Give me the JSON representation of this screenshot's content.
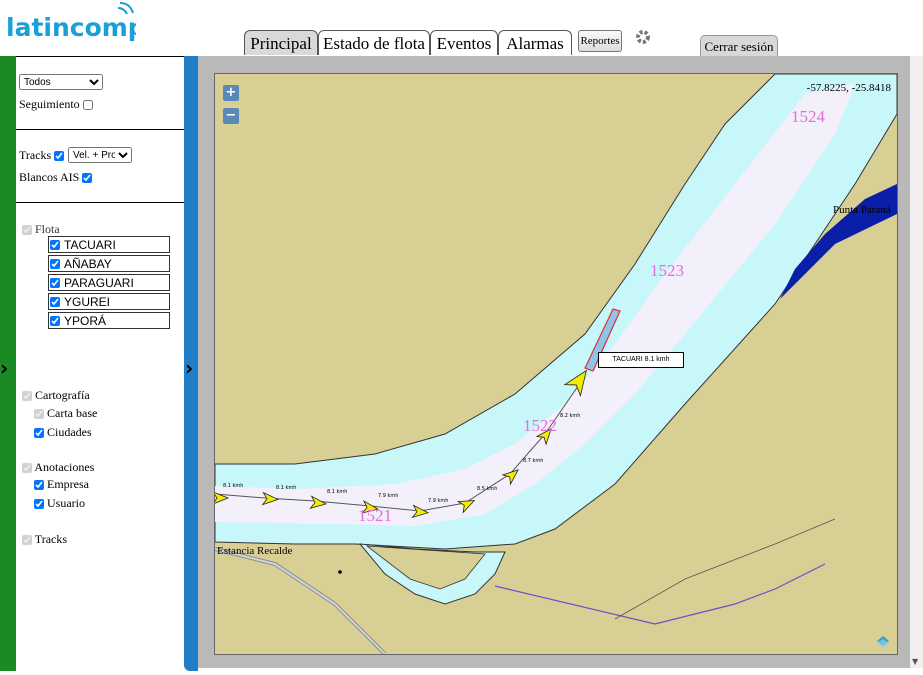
{
  "app": {
    "logo_text": "latincomp"
  },
  "nav": {
    "tabs": [
      "Principal",
      "Estado de flota",
      "Eventos",
      "Alarmas"
    ],
    "reportes": "Reportes",
    "logout": "Cerrar sesión"
  },
  "panel": {
    "filter_selected": "Todos",
    "seguimiento": "Seguimiento",
    "tracks_label": "Tracks",
    "tracks_mode_selected": "Vel. + Prof.",
    "blancos_ais": "Blancos AIS",
    "flota": "Flota",
    "fleet": [
      {
        "name": "TACUARI"
      },
      {
        "name": "AÑABAY"
      },
      {
        "name": "PARAGUARI"
      },
      {
        "name": "YGUREI"
      },
      {
        "name": "YPORÁ"
      }
    ],
    "cartografia": "Cartografía",
    "carta_base": "Carta base",
    "ciudades": "Ciudades",
    "anotaciones": "Anotaciones",
    "empresa": "Empresa",
    "usuario": "Usuario",
    "tracks_layer": "Tracks"
  },
  "map": {
    "coords": "-57.8225, -25.8418",
    "zoom_in": "+",
    "zoom_out": "−",
    "markers": [
      "1524",
      "1523",
      "1522",
      "1521"
    ],
    "places": [
      "Punta Paraná",
      "Estancia Recalde"
    ],
    "vessel_label": "TACUARI  8.1 kmh",
    "speed_labels": [
      "8.1 kmh",
      "8.1 kmh",
      "8.1 kmh",
      "7.9 kmh",
      "7.9 kmh",
      "8.5 kmh",
      "8.7 kmh",
      "8.2 kmh"
    ],
    "colors": {
      "land": "#d8cf95",
      "channel": "#c8f7f9",
      "navigable": "#f3f0fb",
      "deep": "#0a1ea8",
      "track_arrow": "#f4ec00"
    }
  }
}
